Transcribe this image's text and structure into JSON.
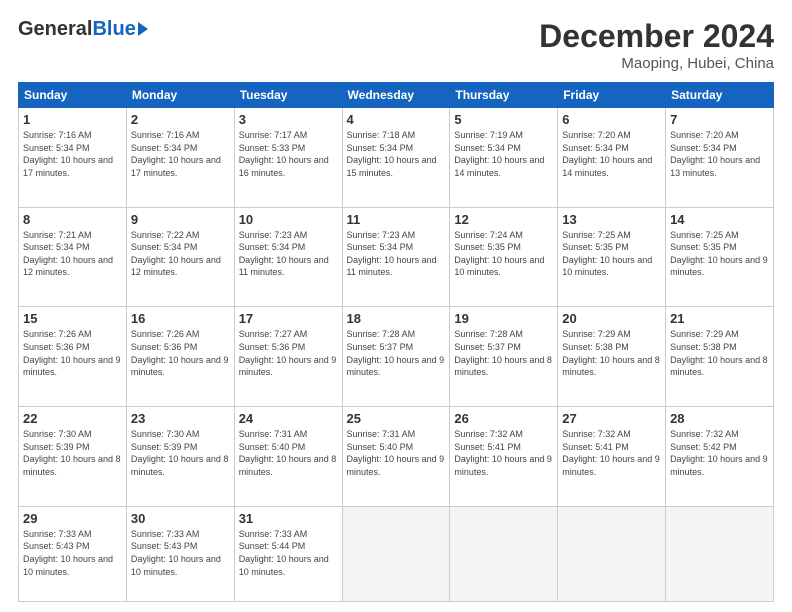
{
  "logo": {
    "general": "General",
    "blue": "Blue"
  },
  "title": "December 2024",
  "location": "Maoping, Hubei, China",
  "days_of_week": [
    "Sunday",
    "Monday",
    "Tuesday",
    "Wednesday",
    "Thursday",
    "Friday",
    "Saturday"
  ],
  "weeks": [
    [
      {
        "day": 1,
        "sunrise": "7:16 AM",
        "sunset": "5:34 PM",
        "daylight": "10 hours and 17 minutes."
      },
      {
        "day": 2,
        "sunrise": "7:16 AM",
        "sunset": "5:34 PM",
        "daylight": "10 hours and 17 minutes."
      },
      {
        "day": 3,
        "sunrise": "7:17 AM",
        "sunset": "5:33 PM",
        "daylight": "10 hours and 16 minutes."
      },
      {
        "day": 4,
        "sunrise": "7:18 AM",
        "sunset": "5:34 PM",
        "daylight": "10 hours and 15 minutes."
      },
      {
        "day": 5,
        "sunrise": "7:19 AM",
        "sunset": "5:34 PM",
        "daylight": "10 hours and 14 minutes."
      },
      {
        "day": 6,
        "sunrise": "7:20 AM",
        "sunset": "5:34 PM",
        "daylight": "10 hours and 14 minutes."
      },
      {
        "day": 7,
        "sunrise": "7:20 AM",
        "sunset": "5:34 PM",
        "daylight": "10 hours and 13 minutes."
      }
    ],
    [
      {
        "day": 8,
        "sunrise": "7:21 AM",
        "sunset": "5:34 PM",
        "daylight": "10 hours and 12 minutes."
      },
      {
        "day": 9,
        "sunrise": "7:22 AM",
        "sunset": "5:34 PM",
        "daylight": "10 hours and 12 minutes."
      },
      {
        "day": 10,
        "sunrise": "7:23 AM",
        "sunset": "5:34 PM",
        "daylight": "10 hours and 11 minutes."
      },
      {
        "day": 11,
        "sunrise": "7:23 AM",
        "sunset": "5:34 PM",
        "daylight": "10 hours and 11 minutes."
      },
      {
        "day": 12,
        "sunrise": "7:24 AM",
        "sunset": "5:35 PM",
        "daylight": "10 hours and 10 minutes."
      },
      {
        "day": 13,
        "sunrise": "7:25 AM",
        "sunset": "5:35 PM",
        "daylight": "10 hours and 10 minutes."
      },
      {
        "day": 14,
        "sunrise": "7:25 AM",
        "sunset": "5:35 PM",
        "daylight": "10 hours and 9 minutes."
      }
    ],
    [
      {
        "day": 15,
        "sunrise": "7:26 AM",
        "sunset": "5:36 PM",
        "daylight": "10 hours and 9 minutes."
      },
      {
        "day": 16,
        "sunrise": "7:26 AM",
        "sunset": "5:36 PM",
        "daylight": "10 hours and 9 minutes."
      },
      {
        "day": 17,
        "sunrise": "7:27 AM",
        "sunset": "5:36 PM",
        "daylight": "10 hours and 9 minutes."
      },
      {
        "day": 18,
        "sunrise": "7:28 AM",
        "sunset": "5:37 PM",
        "daylight": "10 hours and 9 minutes."
      },
      {
        "day": 19,
        "sunrise": "7:28 AM",
        "sunset": "5:37 PM",
        "daylight": "10 hours and 8 minutes."
      },
      {
        "day": 20,
        "sunrise": "7:29 AM",
        "sunset": "5:38 PM",
        "daylight": "10 hours and 8 minutes."
      },
      {
        "day": 21,
        "sunrise": "7:29 AM",
        "sunset": "5:38 PM",
        "daylight": "10 hours and 8 minutes."
      }
    ],
    [
      {
        "day": 22,
        "sunrise": "7:30 AM",
        "sunset": "5:39 PM",
        "daylight": "10 hours and 8 minutes."
      },
      {
        "day": 23,
        "sunrise": "7:30 AM",
        "sunset": "5:39 PM",
        "daylight": "10 hours and 8 minutes."
      },
      {
        "day": 24,
        "sunrise": "7:31 AM",
        "sunset": "5:40 PM",
        "daylight": "10 hours and 8 minutes."
      },
      {
        "day": 25,
        "sunrise": "7:31 AM",
        "sunset": "5:40 PM",
        "daylight": "10 hours and 9 minutes."
      },
      {
        "day": 26,
        "sunrise": "7:32 AM",
        "sunset": "5:41 PM",
        "daylight": "10 hours and 9 minutes."
      },
      {
        "day": 27,
        "sunrise": "7:32 AM",
        "sunset": "5:41 PM",
        "daylight": "10 hours and 9 minutes."
      },
      {
        "day": 28,
        "sunrise": "7:32 AM",
        "sunset": "5:42 PM",
        "daylight": "10 hours and 9 minutes."
      }
    ],
    [
      {
        "day": 29,
        "sunrise": "7:33 AM",
        "sunset": "5:43 PM",
        "daylight": "10 hours and 10 minutes."
      },
      {
        "day": 30,
        "sunrise": "7:33 AM",
        "sunset": "5:43 PM",
        "daylight": "10 hours and 10 minutes."
      },
      {
        "day": 31,
        "sunrise": "7:33 AM",
        "sunset": "5:44 PM",
        "daylight": "10 hours and 10 minutes."
      },
      null,
      null,
      null,
      null
    ]
  ]
}
